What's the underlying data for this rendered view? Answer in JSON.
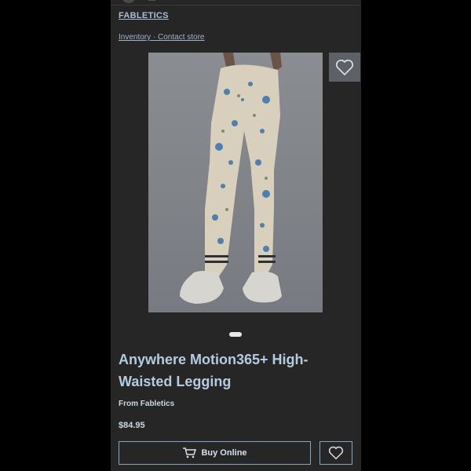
{
  "status": {
    "text": "g"
  },
  "header": {
    "brand": "FABLETICS",
    "links": "Inventory · Contact store"
  },
  "product": {
    "title": "Anywhere Motion365+ High-Waisted Legging",
    "from": "From Fabletics",
    "price": "$84.95",
    "buy_label": "Buy Online",
    "image_alt": "Floral print high-waisted legging worn with white sneakers"
  },
  "carousel": {
    "current": 1,
    "total": 1
  },
  "colors": {
    "background": "#262626",
    "title": "#b4cce0",
    "link": "#9fb2c8",
    "button_border": "#8aa6bf"
  }
}
